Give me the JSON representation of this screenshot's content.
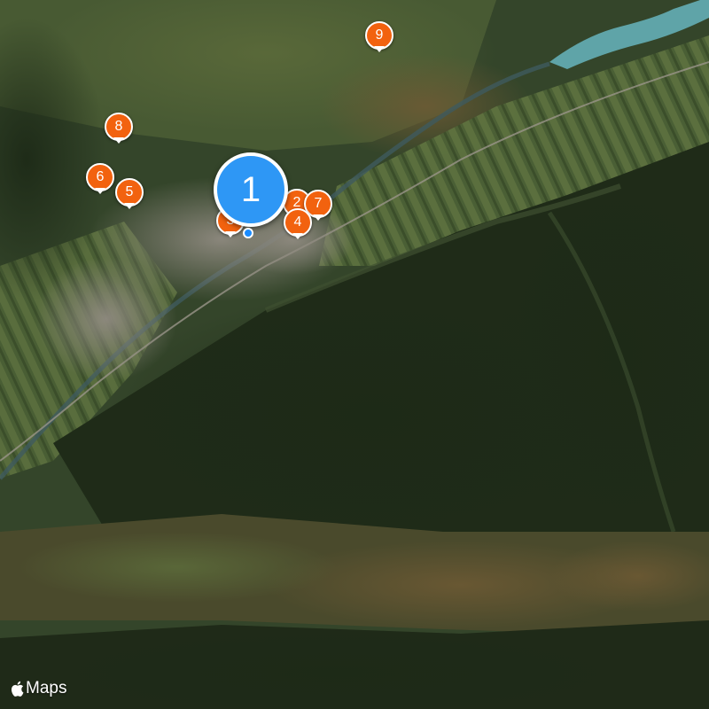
{
  "map": {
    "view": "satellite",
    "attribution": "Maps",
    "attribution_icon": "apple-logo-icon",
    "accent_color": "#2e97f5",
    "pin_color": "#f2620f",
    "selected_pin": {
      "label": "1"
    },
    "pins": [
      {
        "label": "2"
      },
      {
        "label": "3"
      },
      {
        "label": "4"
      },
      {
        "label": "5"
      },
      {
        "label": "6"
      },
      {
        "label": "7"
      },
      {
        "label": "8"
      },
      {
        "label": "9"
      }
    ]
  }
}
